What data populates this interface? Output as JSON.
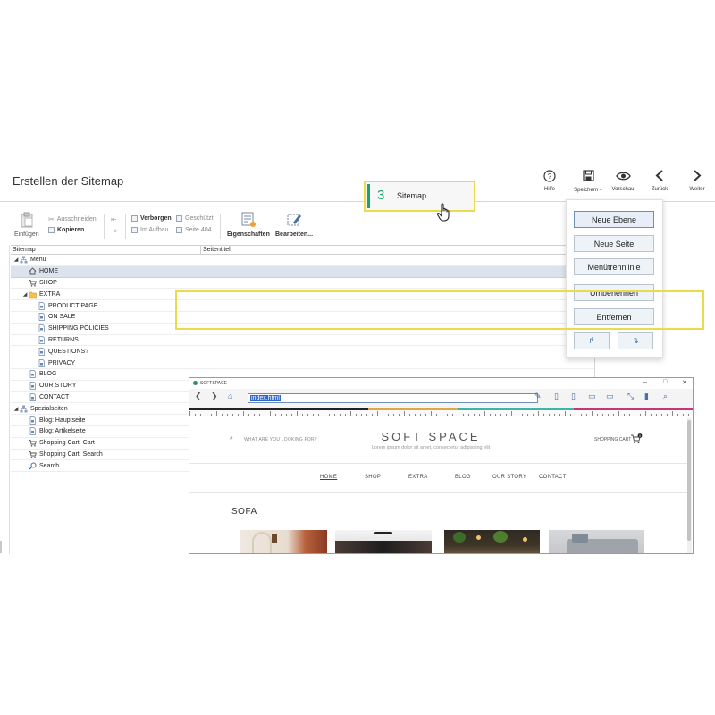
{
  "app": {
    "title": "Erstellen der Sitemap",
    "top_buttons": [
      {
        "label": "Hilfe",
        "icon": "help-icon"
      },
      {
        "label": "Speichern ▾",
        "icon": "save-icon"
      },
      {
        "label": "Vorschau",
        "icon": "eye-icon"
      },
      {
        "label": "Zurück",
        "icon": "chevron-left-icon"
      },
      {
        "label": "Weiter",
        "icon": "chevron-right-icon"
      }
    ]
  },
  "step_badge": {
    "number": "3",
    "label": "Sitemap",
    "accent": "#1aa36c",
    "highlight": "#e9dc4a"
  },
  "ribbon": {
    "paste": "Einfügen",
    "cut": "Ausschneiden",
    "copy": "Kopieren",
    "hidden": "Verborgen",
    "protected": "Geschützt",
    "under_construction": "Im Aufbau",
    "page404": "Seite 404",
    "properties": "Eigenschaften",
    "edit": "Bearbeiten..."
  },
  "tree": {
    "col_sitemap": "Sitemap",
    "col_pagetitle": "Seitentitel",
    "rows": [
      {
        "label": "Menü",
        "level": 0,
        "twisty": "◢",
        "icon": "sitemap-icon"
      },
      {
        "label": "HOME",
        "level": 1,
        "icon": "home-icon",
        "selected": true
      },
      {
        "label": "SHOP",
        "level": 1,
        "icon": "cart-icon"
      },
      {
        "label": "EXTRA",
        "level": 1,
        "twisty": "◢",
        "icon": "folder-icon"
      },
      {
        "label": "PRODUCT PAGE",
        "level": 2,
        "icon": "page-icon"
      },
      {
        "label": "ON SALE",
        "level": 2,
        "icon": "page-icon"
      },
      {
        "label": "SHIPPING POLICIES",
        "level": 2,
        "icon": "page-icon"
      },
      {
        "label": "RETURNS",
        "level": 2,
        "icon": "page-icon"
      },
      {
        "label": "QUESTIONS?",
        "level": 2,
        "icon": "page-icon"
      },
      {
        "label": "PRIVACY",
        "level": 2,
        "icon": "page-icon"
      },
      {
        "label": "BLOG",
        "level": 1,
        "icon": "page-icon"
      },
      {
        "label": "OUR STORY",
        "level": 1,
        "icon": "page-icon"
      },
      {
        "label": "CONTACT",
        "level": 1,
        "icon": "page-icon"
      },
      {
        "label": "Spezialseiten",
        "level": 0,
        "twisty": "◢",
        "icon": "sitemap-icon"
      },
      {
        "label": "Blog: Hauptseite",
        "level": 1,
        "icon": "page-icon"
      },
      {
        "label": "Blog: Artikelseite",
        "level": 1,
        "icon": "page-icon"
      },
      {
        "label": "Shopping Cart: Cart",
        "level": 1,
        "icon": "cart-icon"
      },
      {
        "label": "Shopping Cart: Search",
        "level": 1,
        "icon": "cart-icon"
      },
      {
        "label": "Search",
        "level": 1,
        "icon": "search-icon"
      }
    ]
  },
  "menu": {
    "buttons": [
      "Neue Ebene",
      "Neue Seite",
      "Menütrennlinie",
      "Umbenennen",
      "Entfernen"
    ],
    "move_up": "↱",
    "move_down": "↴"
  },
  "preview": {
    "window_title": "SOFTSPACE",
    "url": "index.html",
    "site": {
      "search_placeholder": "WHAT ARE YOU LOOKING FOR?",
      "logo": "SOFT SPACE",
      "tagline": "Lorem ipsum dolor sit amet, consectetur adipiscing elit",
      "cart_label": "SHOPPING CART",
      "cart_count": "0",
      "nav": [
        "HOME",
        "SHOP",
        "EXTRA",
        "BLOG",
        "OUR STORY",
        "CONTACT"
      ],
      "section_title": "SOFA"
    }
  }
}
